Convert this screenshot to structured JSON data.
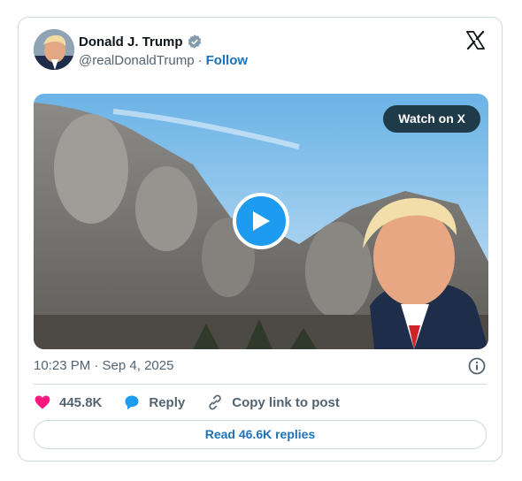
{
  "author": {
    "name": "Donald J. Trump",
    "handle": "@realDonaldTrump",
    "separator": "·",
    "follow_label": "Follow"
  },
  "media": {
    "watch_label": "Watch on X"
  },
  "timestamp": "10:23 PM · Sep 4, 2025",
  "actions": {
    "like_count": "445.8K",
    "reply_label": "Reply",
    "copy_label": "Copy link to post"
  },
  "replies_button": "Read 46.6K replies",
  "colors": {
    "accent": "#1d9bf0",
    "link": "#1d72b8",
    "like": "#f91880",
    "border": "#cfd9de"
  }
}
